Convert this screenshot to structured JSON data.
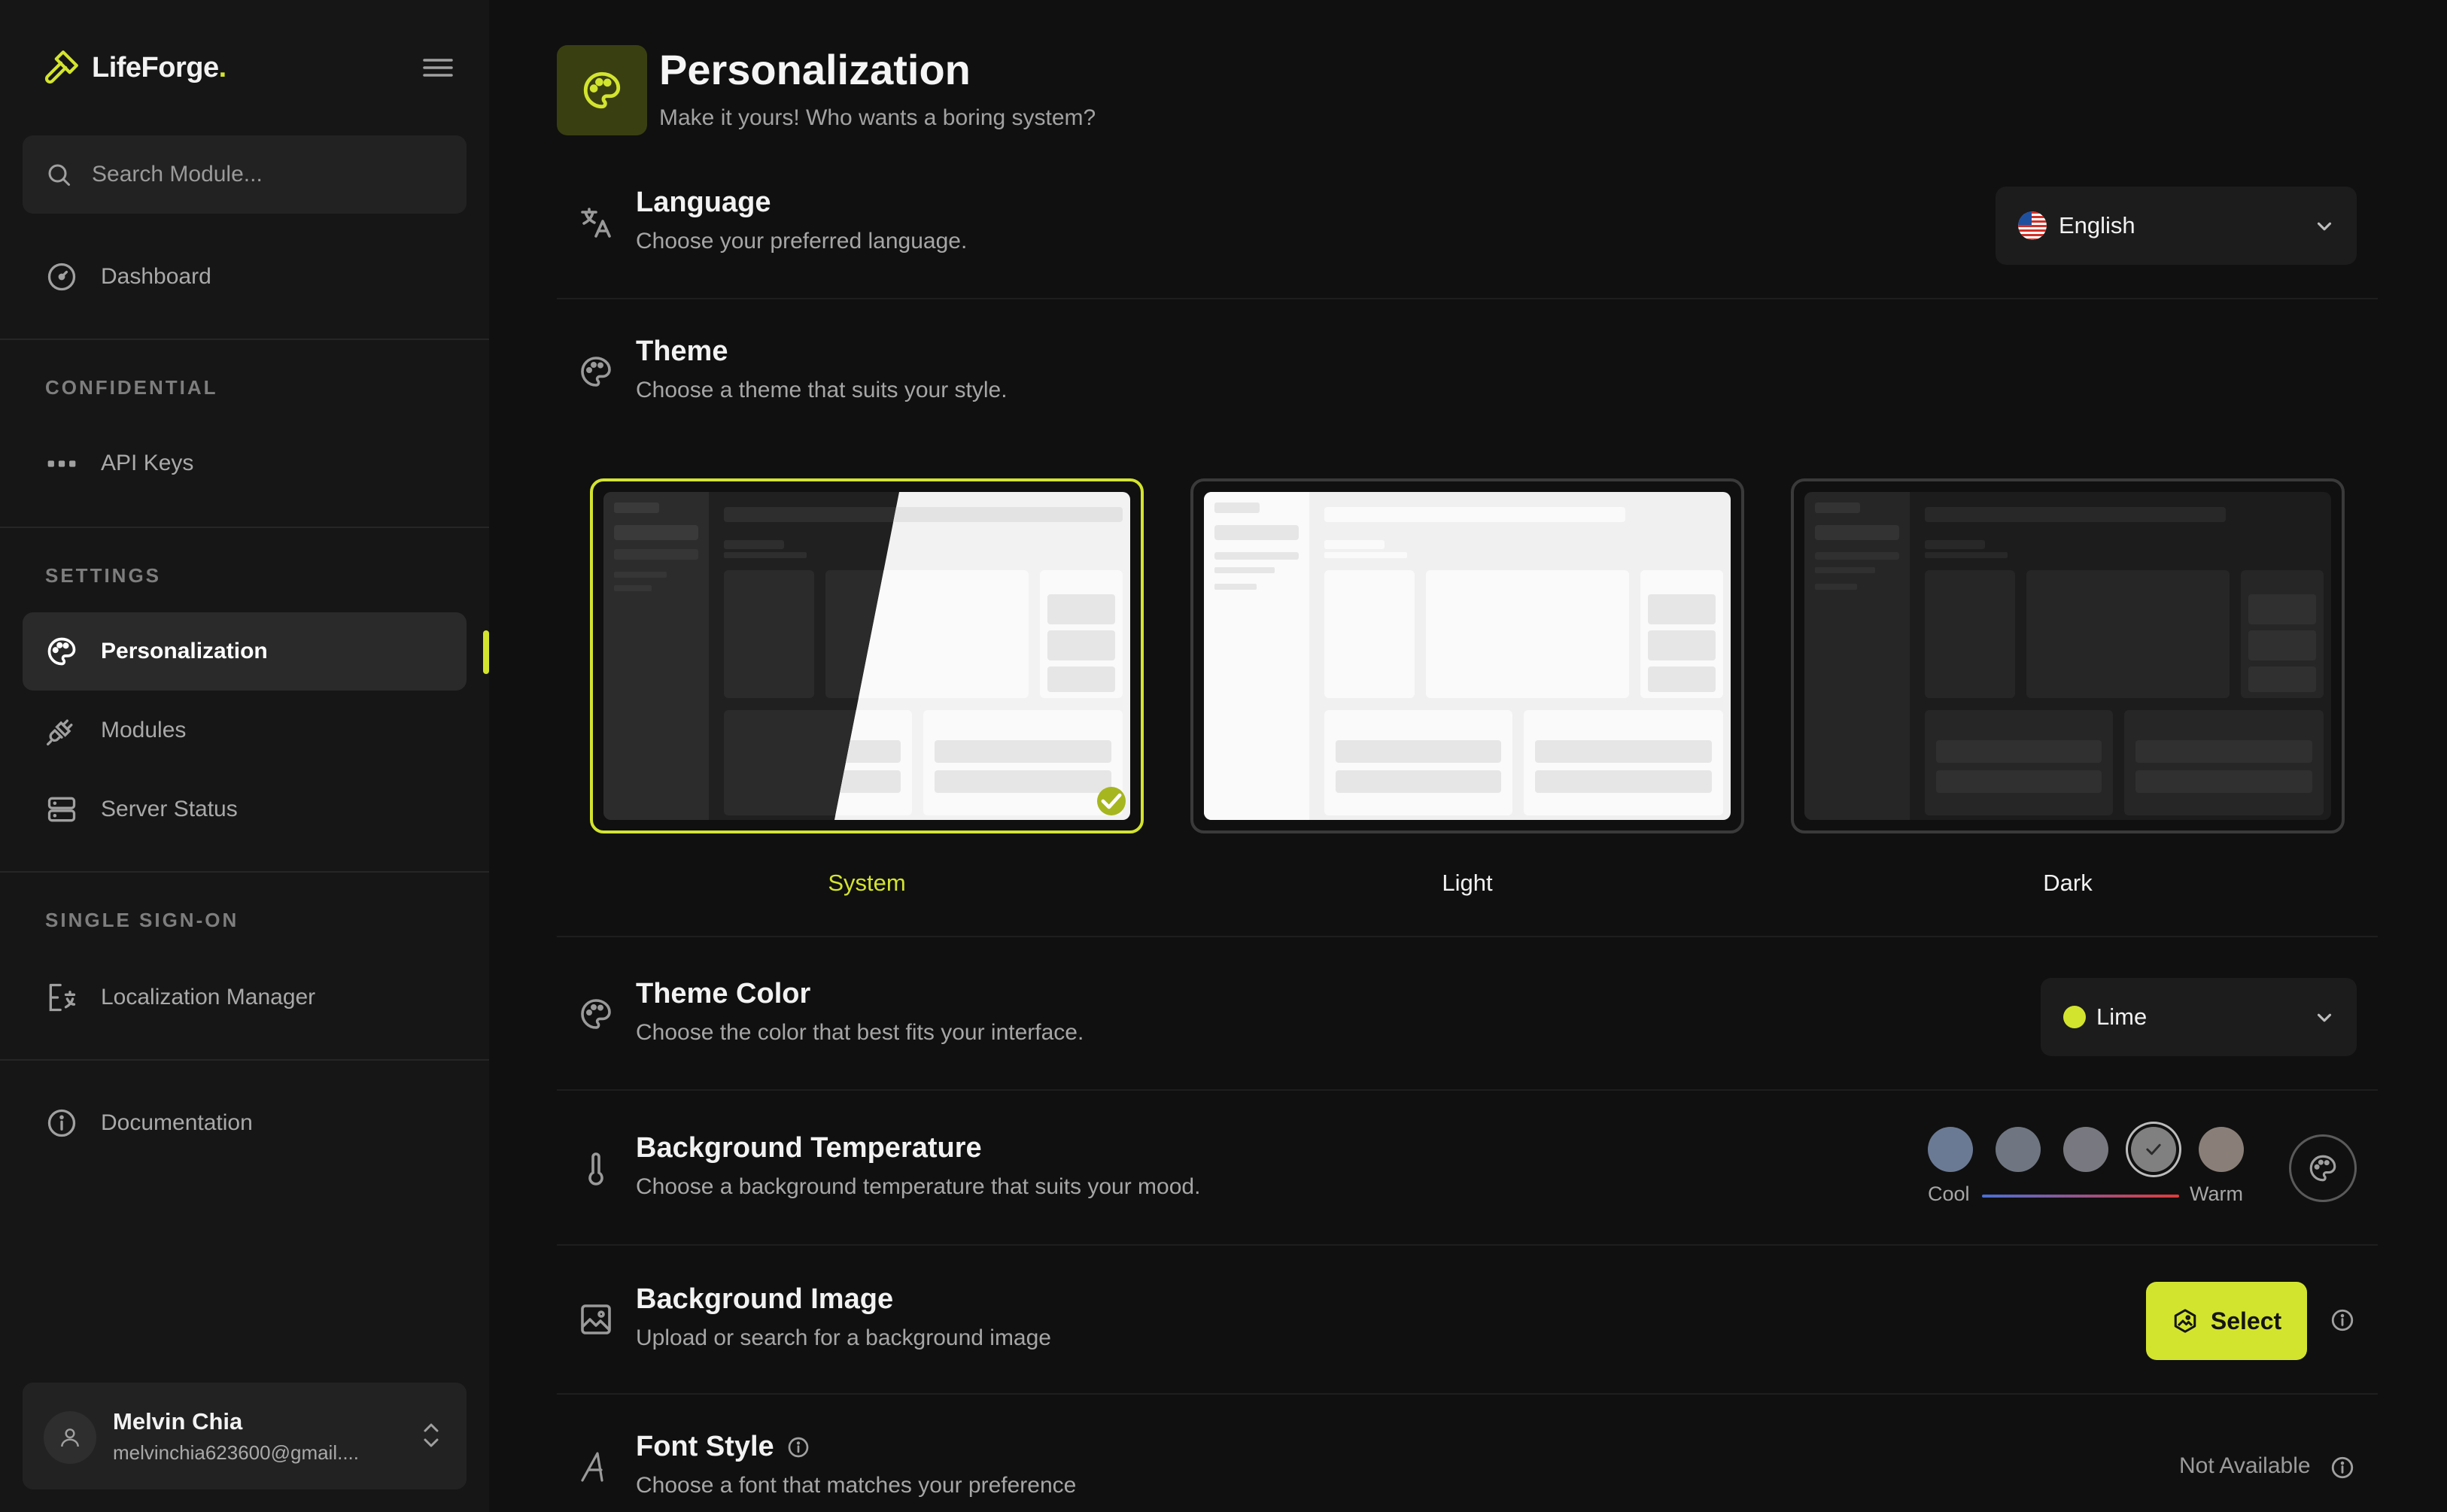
{
  "brand": {
    "name": "LifeForge",
    "dot": "."
  },
  "search": {
    "placeholder": "Search Module..."
  },
  "sidebar": {
    "dashboard": "Dashboard",
    "sections": {
      "confidential": "CONFIDENTIAL",
      "settings": "SETTINGS",
      "sso": "SINGLE SIGN-ON"
    },
    "api_keys": "API Keys",
    "personalization": "Personalization",
    "modules": "Modules",
    "server_status": "Server Status",
    "localization_manager": "Localization Manager",
    "documentation": "Documentation",
    "active_item": "Personalization"
  },
  "user": {
    "name": "Melvin Chia",
    "email": "melvinchia623600@gmail...."
  },
  "page": {
    "title": "Personalization",
    "subtitle": "Make it yours! Who wants a boring system?"
  },
  "language": {
    "title": "Language",
    "description": "Choose your preferred language.",
    "selected": "English",
    "flag": "us-flag"
  },
  "theme": {
    "title": "Theme",
    "description": "Choose a theme that suits your style.",
    "options": [
      "System",
      "Light",
      "Dark"
    ],
    "selected": "System"
  },
  "theme_color": {
    "title": "Theme Color",
    "description": "Choose the color that best fits your interface.",
    "selected": "Lime",
    "swatch": "#d3e42f"
  },
  "background_temperature": {
    "title": "Background Temperature",
    "description": "Choose a background temperature that suits your mood.",
    "swatches": [
      "#6b7a94",
      "#6f7682",
      "#787880",
      "#808080",
      "#8a7f78"
    ],
    "selected_index": 3,
    "cool_label": "Cool",
    "warm_label": "Warm"
  },
  "background_image": {
    "title": "Background Image",
    "description": "Upload or search for a background image",
    "button": "Select"
  },
  "font_style": {
    "title": "Font Style",
    "description": "Choose a font that matches your preference",
    "status": "Not Available"
  },
  "colors": {
    "accent": "#d3e42f",
    "background": "#101010",
    "sidebar": "#161616"
  }
}
